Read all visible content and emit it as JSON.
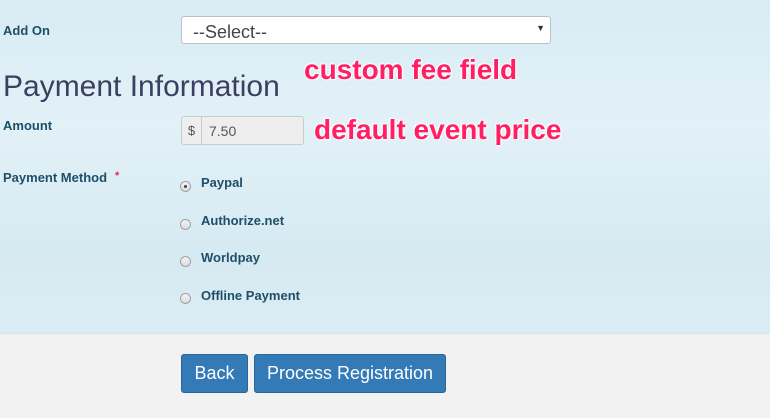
{
  "add_on": {
    "label": "Add On",
    "selected": "--Select--"
  },
  "payment": {
    "title": "Payment Information",
    "amount_label": "Amount",
    "currency_symbol": "$",
    "amount_value": "7.50",
    "method_label": "Payment Method",
    "required_mark": "*",
    "methods": [
      {
        "label": "Paypal",
        "checked": true
      },
      {
        "label": "Authorize.net",
        "checked": false
      },
      {
        "label": "Worldpay",
        "checked": false
      },
      {
        "label": "Offline Payment",
        "checked": false
      }
    ]
  },
  "annotations": {
    "custom_fee": "custom fee field",
    "default_price": "default event price"
  },
  "buttons": {
    "back": "Back",
    "process": "Process Registration"
  },
  "colors": {
    "button": "#337ab7",
    "annotation": "#ff1f62",
    "label": "#1f4e68"
  }
}
